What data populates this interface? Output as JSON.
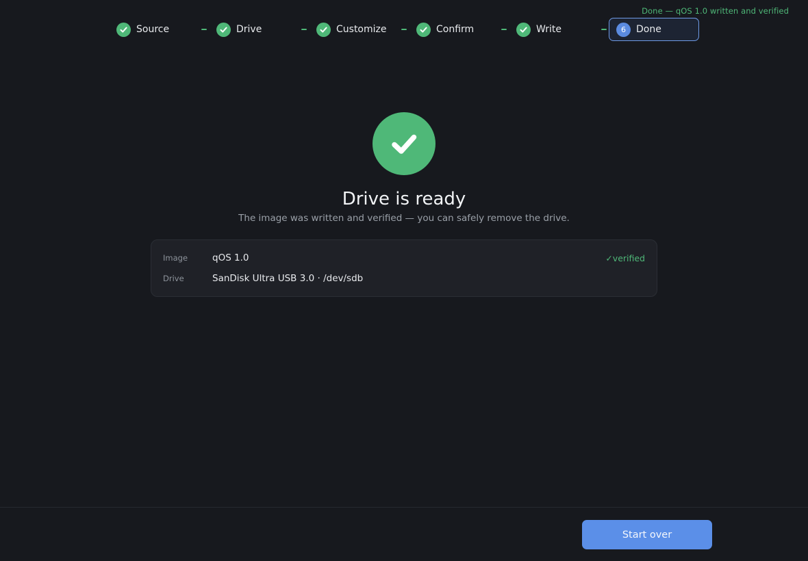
{
  "status": {
    "text": "Done — qOS 1.0 written and verified",
    "color": "#4fb878"
  },
  "stepper": {
    "steps": [
      {
        "label": "Source",
        "state": "completed",
        "icon": "check-icon"
      },
      {
        "label": "Drive",
        "state": "completed",
        "icon": "check-icon"
      },
      {
        "label": "Customize",
        "state": "completed",
        "icon": "check-icon"
      },
      {
        "label": "Confirm",
        "state": "completed",
        "icon": "check-icon"
      },
      {
        "label": "Write",
        "state": "completed",
        "icon": "check-icon"
      },
      {
        "label": "Done",
        "state": "active",
        "number": "6"
      }
    ]
  },
  "result": {
    "icon": "check-circle-icon",
    "title": "Drive is ready",
    "subtitle": "The image was written and verified — you can safely remove the drive."
  },
  "summary": {
    "image_key": "Image",
    "image_value": "qOS 1.0",
    "drive_key": "Drive",
    "drive_value": "SanDisk Ultra USB 3.0 · /dev/sdb",
    "verified_glyph": "✓",
    "verified_label": "verified"
  },
  "footer": {
    "primary_button": "Start over"
  },
  "colors": {
    "background": "#17191e",
    "success": "#4fb878",
    "accent": "#5b8fe8",
    "card": "#1f2127"
  }
}
